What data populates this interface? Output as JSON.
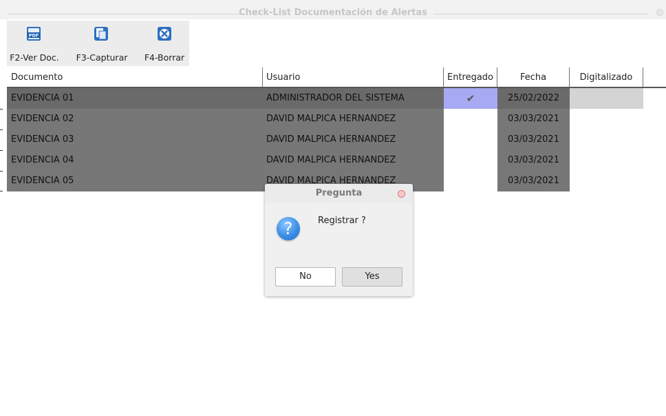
{
  "window": {
    "title": "Check-List Documentación de Alertas"
  },
  "toolbar": [
    {
      "label": "F2-Ver Doc.",
      "icon": "pdf-icon"
    },
    {
      "label": "F3-Capturar",
      "icon": "document-copy-icon"
    },
    {
      "label": "F4-Borrar",
      "icon": "delete-x-icon"
    }
  ],
  "table": {
    "columns": [
      "Documento",
      "Usuario",
      "Entregado",
      "Fecha",
      "Digitalizado"
    ],
    "rows": [
      {
        "documento": "EVIDENCIA 01",
        "usuario": "ADMINISTRADOR DEL SISTEMA",
        "entregado": "✔",
        "fecha": "25/02/2022",
        "digitalizado": ""
      },
      {
        "documento": "EVIDENCIA 02",
        "usuario": "DAVID MALPICA HERNANDEZ",
        "entregado": "",
        "fecha": "03/03/2021",
        "digitalizado": ""
      },
      {
        "documento": "EVIDENCIA 03",
        "usuario": "DAVID MALPICA HERNANDEZ",
        "entregado": "",
        "fecha": "03/03/2021",
        "digitalizado": ""
      },
      {
        "documento": "EVIDENCIA 04",
        "usuario": "DAVID MALPICA HERNANDEZ",
        "entregado": "",
        "fecha": "03/03/2021",
        "digitalizado": ""
      },
      {
        "documento": "EVIDENCIA 05",
        "usuario": "DAVID MALPICA HERNANDEZ",
        "entregado": "",
        "fecha": "03/03/2021",
        "digitalizado": ""
      }
    ]
  },
  "dialog": {
    "title": "Pregunta",
    "message": "Registrar ?",
    "no_label": "No",
    "yes_label": "Yes",
    "icon": "question-icon"
  }
}
